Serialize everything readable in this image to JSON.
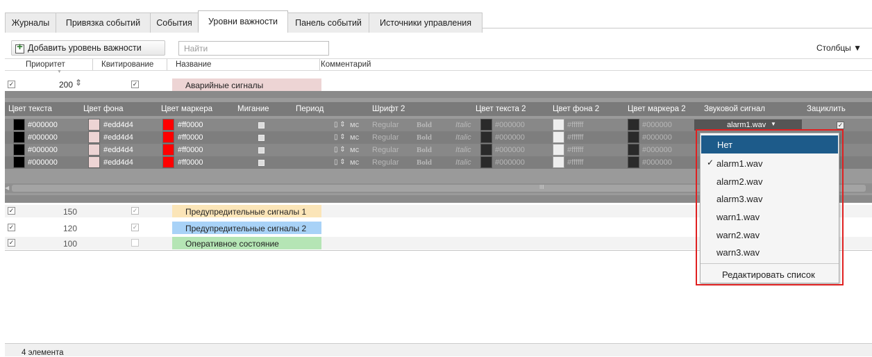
{
  "tabs": [
    {
      "label": "Журналы"
    },
    {
      "label": "Привязка событий"
    },
    {
      "label": "События"
    },
    {
      "label": "Уровни важности",
      "active": true
    },
    {
      "label": "Панель событий"
    },
    {
      "label": "Источники управления"
    }
  ],
  "toolbar": {
    "add_label": "Добавить уровень важности",
    "search_placeholder": "Найти",
    "columns_label": "Столбцы ▼"
  },
  "main_columns": [
    "Приоритет",
    "Квитирование",
    "Название",
    "Комментарий"
  ],
  "main_rows": [
    {
      "priority": "200",
      "ack": true,
      "name": "Аварийные сигналы",
      "name_color": "#edd4d4",
      "expanded": true
    },
    {
      "priority": "150",
      "ack": true,
      "name": "Предупредительные сигналы 1",
      "name_color": "#fbe5b8"
    },
    {
      "priority": "120",
      "ack": true,
      "name": "Предупредительные сигналы 2",
      "name_color": "#a8d2f7"
    },
    {
      "priority": "100",
      "ack": false,
      "name": "Оперативное состояние",
      "name_color": "#b5e5b5"
    }
  ],
  "sub_columns": [
    "Цвет текста",
    "Цвет фона",
    "Цвет маркера",
    "Мигание",
    "Период",
    "Шрифт 2",
    "Цвет текста 2",
    "Цвет фона 2",
    "Цвет маркера 2",
    "Звуковой сигнал",
    "Зациклить"
  ],
  "sub_rows": [
    {
      "text_color": "#000000",
      "bg_color": "#edd4d4",
      "marker_color": "#ff0000",
      "unit": "мс",
      "font_regular": "Regular",
      "font_bold": "Bold",
      "font_italic": "Italic",
      "text_color2": "#000000",
      "bg_color2": "#ffffff",
      "marker_color2": "#000000",
      "sound": "alarm1.wav"
    },
    {
      "text_color": "#000000",
      "bg_color": "#edd4d4",
      "marker_color": "#ff0000",
      "unit": "мс",
      "font_regular": "Regular",
      "font_bold": "Bold",
      "font_italic": "Italic",
      "text_color2": "#000000",
      "bg_color2": "#ffffff",
      "marker_color2": "#000000"
    },
    {
      "text_color": "#000000",
      "bg_color": "#edd4d4",
      "marker_color": "#ff0000",
      "unit": "мс",
      "font_regular": "Regular",
      "font_bold": "Bold",
      "font_italic": "Italic",
      "text_color2": "#000000",
      "bg_color2": "#ffffff",
      "marker_color2": "#000000"
    },
    {
      "text_color": "#000000",
      "bg_color": "#edd4d4",
      "marker_color": "#ff0000",
      "unit": "мс",
      "font_regular": "Regular",
      "font_bold": "Bold",
      "font_italic": "Italic",
      "text_color2": "#000000",
      "bg_color2": "#ffffff",
      "marker_color2": "#000000"
    }
  ],
  "dropdown": {
    "items": [
      {
        "label": "Нет",
        "selected": true
      },
      {
        "label": "alarm1.wav",
        "checked": true
      },
      {
        "label": "alarm2.wav"
      },
      {
        "label": "alarm3.wav"
      },
      {
        "label": "warn1.wav"
      },
      {
        "label": "warn2.wav"
      },
      {
        "label": "warn3.wav"
      }
    ],
    "edit_label": "Редактировать список"
  },
  "status": {
    "count_label": "4 элемента"
  },
  "scrollbar_grip": "III",
  "icons": {
    "checkbox": "check-mark",
    "stepper": "up-down-arrows",
    "add": "plus-icon",
    "dropdown_arrow": "triangle-down"
  }
}
